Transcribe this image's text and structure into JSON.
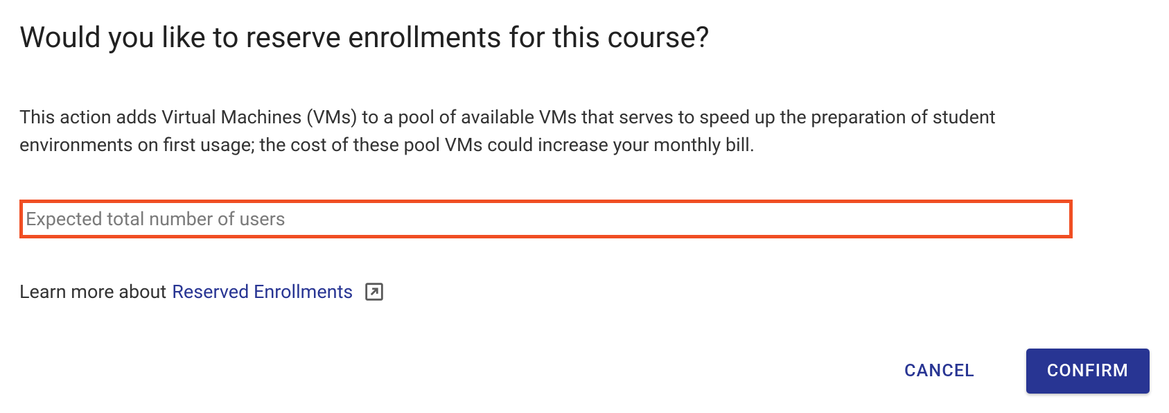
{
  "dialog": {
    "title": "Would you like to reserve enrollments for this course?",
    "description": "This action adds Virtual Machines (VMs) to a pool of available VMs that serves to speed up the preparation of student environments on first usage; the cost of these pool VMs could increase your monthly bill.",
    "input": {
      "placeholder": "Expected total number of users",
      "value": ""
    },
    "learn_more": {
      "prefix": "Learn more about ",
      "link_text": "Reserved Enrollments"
    },
    "actions": {
      "cancel_label": "CANCEL",
      "confirm_label": "CONFIRM"
    }
  }
}
